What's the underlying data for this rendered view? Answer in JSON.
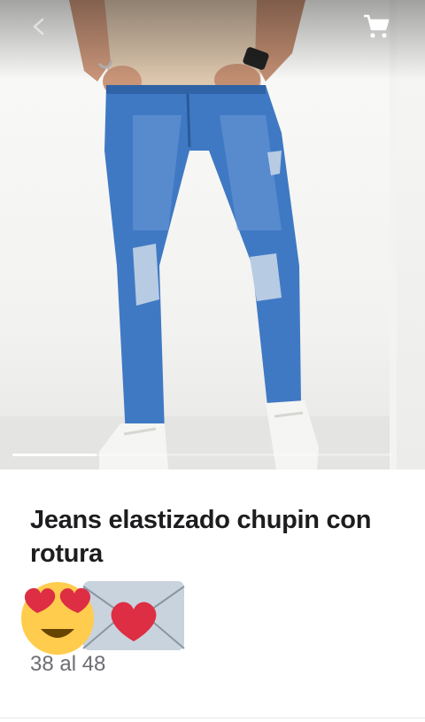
{
  "product": {
    "title": "Jeans elastizado chupin con rotura",
    "sizes": "38 al 48",
    "emojis": [
      "heart-eyes-emoji",
      "love-letter-emoji"
    ]
  },
  "gallery": {
    "image": "jeans-model-photo",
    "progress_fraction": 0.22
  },
  "icons": {
    "back": "back-arrow-icon",
    "cart": "cart-icon"
  },
  "colors": {
    "title": "#1d1d1f",
    "subtitle": "#6d6d73",
    "denim": "#3f79c4"
  }
}
